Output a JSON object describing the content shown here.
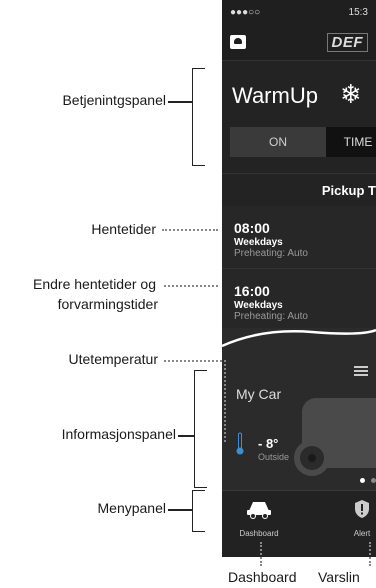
{
  "annotations": {
    "control_panel": "Betjenintgspanel",
    "pickup_times": "Hentetider",
    "edit_line1": "Endre hentetider og",
    "edit_line2": "forvarmingstider",
    "outside_temp": "Utetemperatur",
    "info_panel": "Informasjonspanel",
    "menu_panel": "Menypanel",
    "dashboard": "Dashboard",
    "alerts": "Varslin"
  },
  "status_bar": {
    "signal": "●●●○○",
    "time": "15:3"
  },
  "nav": {
    "brand": "DEF"
  },
  "warmup": {
    "title": "WarmUp",
    "on_label": "ON",
    "timer_label": "TIME"
  },
  "pickup_header": "Pickup T",
  "pickups": [
    {
      "time": "08:00",
      "days": "Weekdays",
      "preheating": "Preheating: Auto"
    },
    {
      "time": "16:00",
      "days": "Weekdays",
      "preheating": "Preheating: Auto"
    }
  ],
  "info": {
    "car_name": "My Car",
    "temperature": "- 8°",
    "temp_label": "Outside"
  },
  "tabs": [
    {
      "label": "Dashboard",
      "icon": "car-icon"
    },
    {
      "label": "Alert",
      "icon": "shield-alert-icon"
    }
  ],
  "colors": {
    "screen_bg": "#1f1f1f",
    "accent_thermometer": "#3b8fd9"
  }
}
